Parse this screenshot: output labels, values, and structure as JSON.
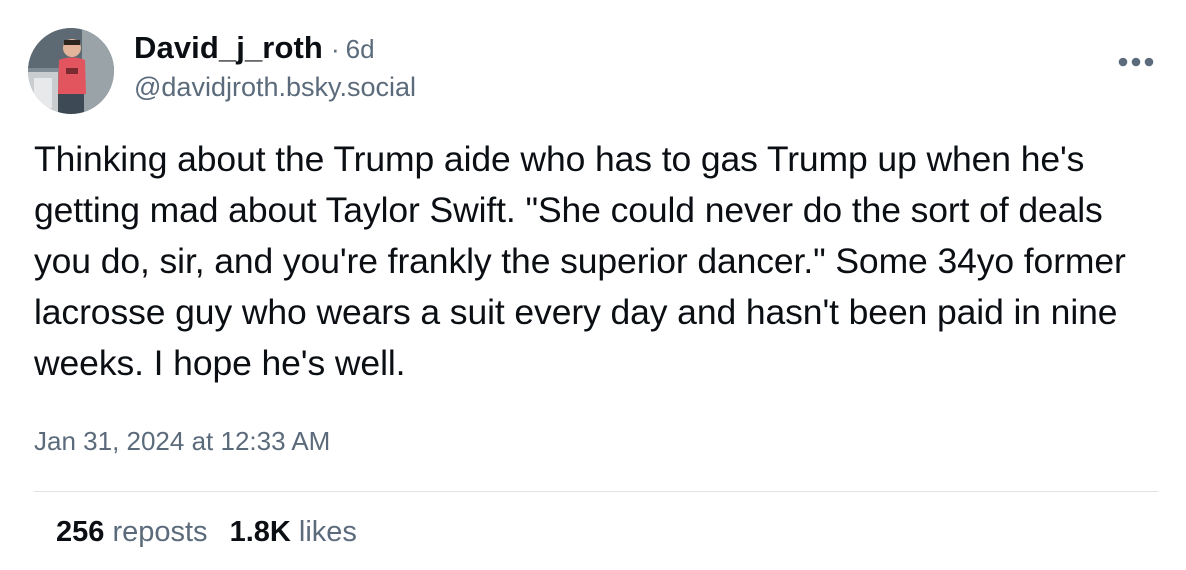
{
  "post": {
    "author": {
      "display_name": "David_j_roth",
      "handle": "@davidjroth.bsky.social",
      "age": "6d",
      "separator": "·"
    },
    "text": "Thinking about the Trump aide who has to gas Trump up when he's getting mad about Taylor Swift. \"She could never do the sort of deals you do, sir, and you're frankly the superior dancer.\" Some 34yo former lacrosse guy who wears a suit every day and hasn't been paid in nine weeks. I hope he's well.",
    "timestamp": "Jan 31, 2024 at 12:33 AM",
    "stats": {
      "reposts_count": "256",
      "reposts_label": "reposts",
      "likes_count": "1.8K",
      "likes_label": "likes"
    }
  },
  "icons": {
    "more": "more-horizontal-icon"
  },
  "colors": {
    "text_primary": "#0b0f14",
    "text_secondary": "#5b6b7b",
    "divider": "#dfe3e8",
    "background": "#ffffff"
  }
}
